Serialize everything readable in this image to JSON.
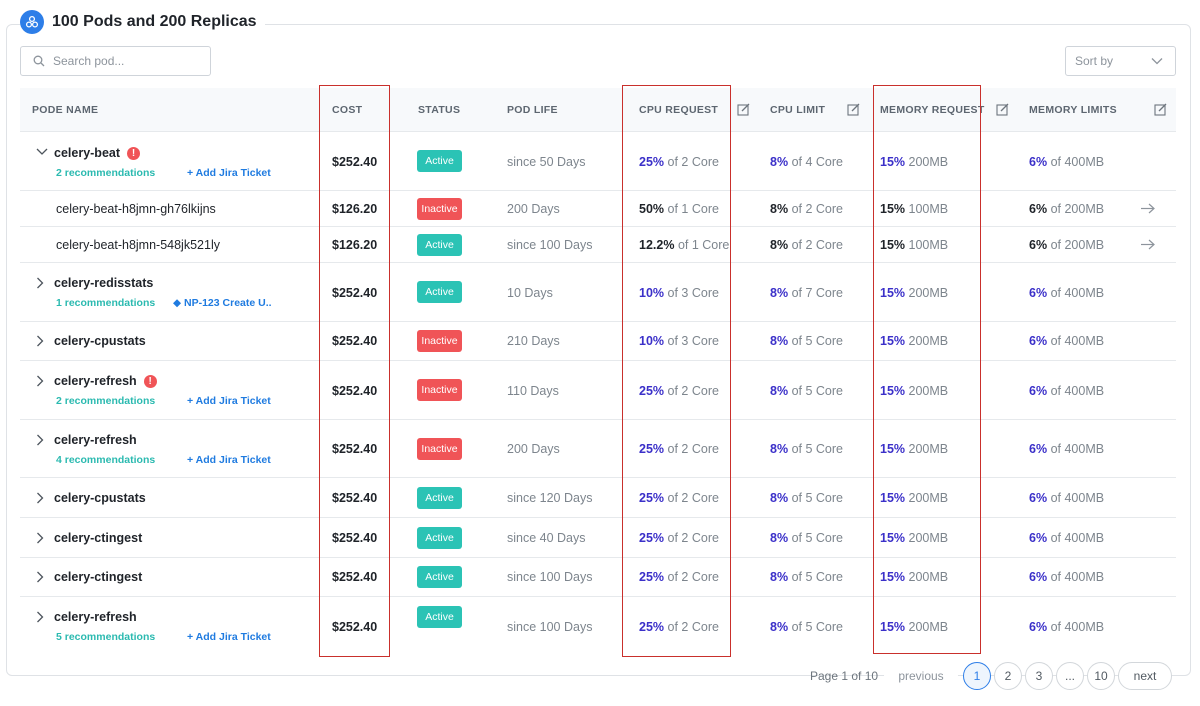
{
  "header": {
    "title": "100 Pods and 200 Replicas"
  },
  "search": {
    "placeholder": "Search pod..."
  },
  "sort": {
    "label": "Sort by"
  },
  "columns": {
    "name": "PODE NAME",
    "cost": "COST",
    "status": "STATUS",
    "life": "POD LIFE",
    "cpu_request": "CPU REQUEST",
    "cpu_limit": "CPU LIMIT",
    "mem_request": "MEMORY REQUEST",
    "mem_limits": "MEMORY LIMITS"
  },
  "rows": [
    {
      "name": "celery-beat",
      "alert": "!",
      "reco": "2 recommendations",
      "jira": "Add Jira Ticket",
      "cost": "$252.40",
      "status": "Active",
      "life": "since 50 Days",
      "cpu_req_pct": "25%",
      "cpu_req_of": "of 2 Core",
      "cpu_lim_pct": "8%",
      "cpu_lim_of": "of 4 Core",
      "mem_req_pct": "15%",
      "mem_req_of": "200MB",
      "mem_lim_pct": "6%",
      "mem_lim_of": "of 400MB"
    },
    {
      "name": "celery-beat-h8jmn-gh76lkijns",
      "cost": "$126.20",
      "status": "Inactive",
      "life": "200 Days",
      "cpu_req_pct": "50%",
      "cpu_req_of": "of 1 Core",
      "cpu_lim_pct": "8%",
      "cpu_lim_of": "of 2 Core",
      "mem_req_pct": "15%",
      "mem_req_of": "100MB",
      "mem_lim_pct": "6%",
      "mem_lim_of": "of 200MB"
    },
    {
      "name": "celery-beat-h8jmn-548jk521ly",
      "cost": "$126.20",
      "status": "Active",
      "life": "since 100 Days",
      "cpu_req_pct": "12.2%",
      "cpu_req_of": "of 1 Core",
      "cpu_lim_pct": "8%",
      "cpu_lim_of": "of 2 Core",
      "mem_req_pct": "15%",
      "mem_req_of": "100MB",
      "mem_lim_pct": "6%",
      "mem_lim_of": "of 200MB"
    },
    {
      "name": "celery-redisstats",
      "reco": "1 recommendations",
      "jira": "NP-123 Create U..",
      "cost": "$252.40",
      "status": "Active",
      "life": "10 Days",
      "cpu_req_pct": "10%",
      "cpu_req_of": "of 3 Core",
      "cpu_lim_pct": "8%",
      "cpu_lim_of": "of 7 Core",
      "mem_req_pct": "15%",
      "mem_req_of": "200MB",
      "mem_lim_pct": "6%",
      "mem_lim_of": "of 400MB"
    },
    {
      "name": "celery-cpustats",
      "cost": "$252.40",
      "status": "Inactive",
      "life": "210 Days",
      "cpu_req_pct": "10%",
      "cpu_req_of": "of 3 Core",
      "cpu_lim_pct": "8%",
      "cpu_lim_of": "of 5 Core",
      "mem_req_pct": "15%",
      "mem_req_of": "200MB",
      "mem_lim_pct": "6%",
      "mem_lim_of": "of 400MB"
    },
    {
      "name": "celery-refresh",
      "alert": "!",
      "reco": "2 recommendations",
      "jira": "Add Jira Ticket",
      "cost": "$252.40",
      "status": "Inactive",
      "life": "110 Days",
      "cpu_req_pct": "25%",
      "cpu_req_of": "of 2 Core",
      "cpu_lim_pct": "8%",
      "cpu_lim_of": "of 5 Core",
      "mem_req_pct": "15%",
      "mem_req_of": "200MB",
      "mem_lim_pct": "6%",
      "mem_lim_of": "of 400MB"
    },
    {
      "name": "celery-refresh",
      "reco": "4 recommendations",
      "jira": "Add Jira Ticket",
      "cost": "$252.40",
      "status": "Inactive",
      "life": "200 Days",
      "cpu_req_pct": "25%",
      "cpu_req_of": "of 2 Core",
      "cpu_lim_pct": "8%",
      "cpu_lim_of": "of 5 Core",
      "mem_req_pct": "15%",
      "mem_req_of": "200MB",
      "mem_lim_pct": "6%",
      "mem_lim_of": "of 400MB"
    },
    {
      "name": "celery-cpustats",
      "cost": "$252.40",
      "status": "Active",
      "life": "since 120 Days",
      "cpu_req_pct": "25%",
      "cpu_req_of": "of 2 Core",
      "cpu_lim_pct": "8%",
      "cpu_lim_of": "of 5 Core",
      "mem_req_pct": "15%",
      "mem_req_of": "200MB",
      "mem_lim_pct": "6%",
      "mem_lim_of": "of 400MB"
    },
    {
      "name": "celery-ctingest",
      "cost": "$252.40",
      "status": "Active",
      "life": "since 40 Days",
      "cpu_req_pct": "25%",
      "cpu_req_of": "of 2 Core",
      "cpu_lim_pct": "8%",
      "cpu_lim_of": "of 5 Core",
      "mem_req_pct": "15%",
      "mem_req_of": "200MB",
      "mem_lim_pct": "6%",
      "mem_lim_of": "of 400MB"
    },
    {
      "name": "celery-ctingest",
      "cost": "$252.40",
      "status": "Active",
      "life": "since 100 Days",
      "cpu_req_pct": "25%",
      "cpu_req_of": "of 2 Core",
      "cpu_lim_pct": "8%",
      "cpu_lim_of": "of 5 Core",
      "mem_req_pct": "15%",
      "mem_req_of": "200MB",
      "mem_lim_pct": "6%",
      "mem_lim_of": "of 400MB"
    },
    {
      "name": "celery-refresh",
      "reco": "5 recommendations",
      "jira": "Add Jira Ticket",
      "cost": "$252.40",
      "status": "Active",
      "life": "since 100 Days",
      "cpu_req_pct": "25%",
      "cpu_req_of": "of 2 Core",
      "cpu_lim_pct": "8%",
      "cpu_lim_of": "of 5 Core",
      "mem_req_pct": "15%",
      "mem_req_of": "200MB",
      "mem_lim_pct": "6%",
      "mem_lim_of": "of 400MB"
    }
  ],
  "pagination": {
    "summary": "Page 1 of 10",
    "previous": "previous",
    "next": "next",
    "pages": [
      "1",
      "2",
      "3",
      "...",
      "10"
    ],
    "current": "1"
  },
  "colors": {
    "accent": "#2d7ee8",
    "active": "#2bc3b5",
    "inactive": "#f05457",
    "highlight": "#c9302c",
    "percent": "#3b30c9"
  },
  "icons": {
    "logo": "cluster-icon",
    "search": "search-icon",
    "sort": "chevron-down-icon",
    "edit": "edit-icon",
    "expand": "chevron-right-icon",
    "collapse": "chevron-down-icon",
    "open": "arrow-right-icon",
    "alert": "alert-icon",
    "add": "plus-icon",
    "jira": "jira-icon"
  }
}
